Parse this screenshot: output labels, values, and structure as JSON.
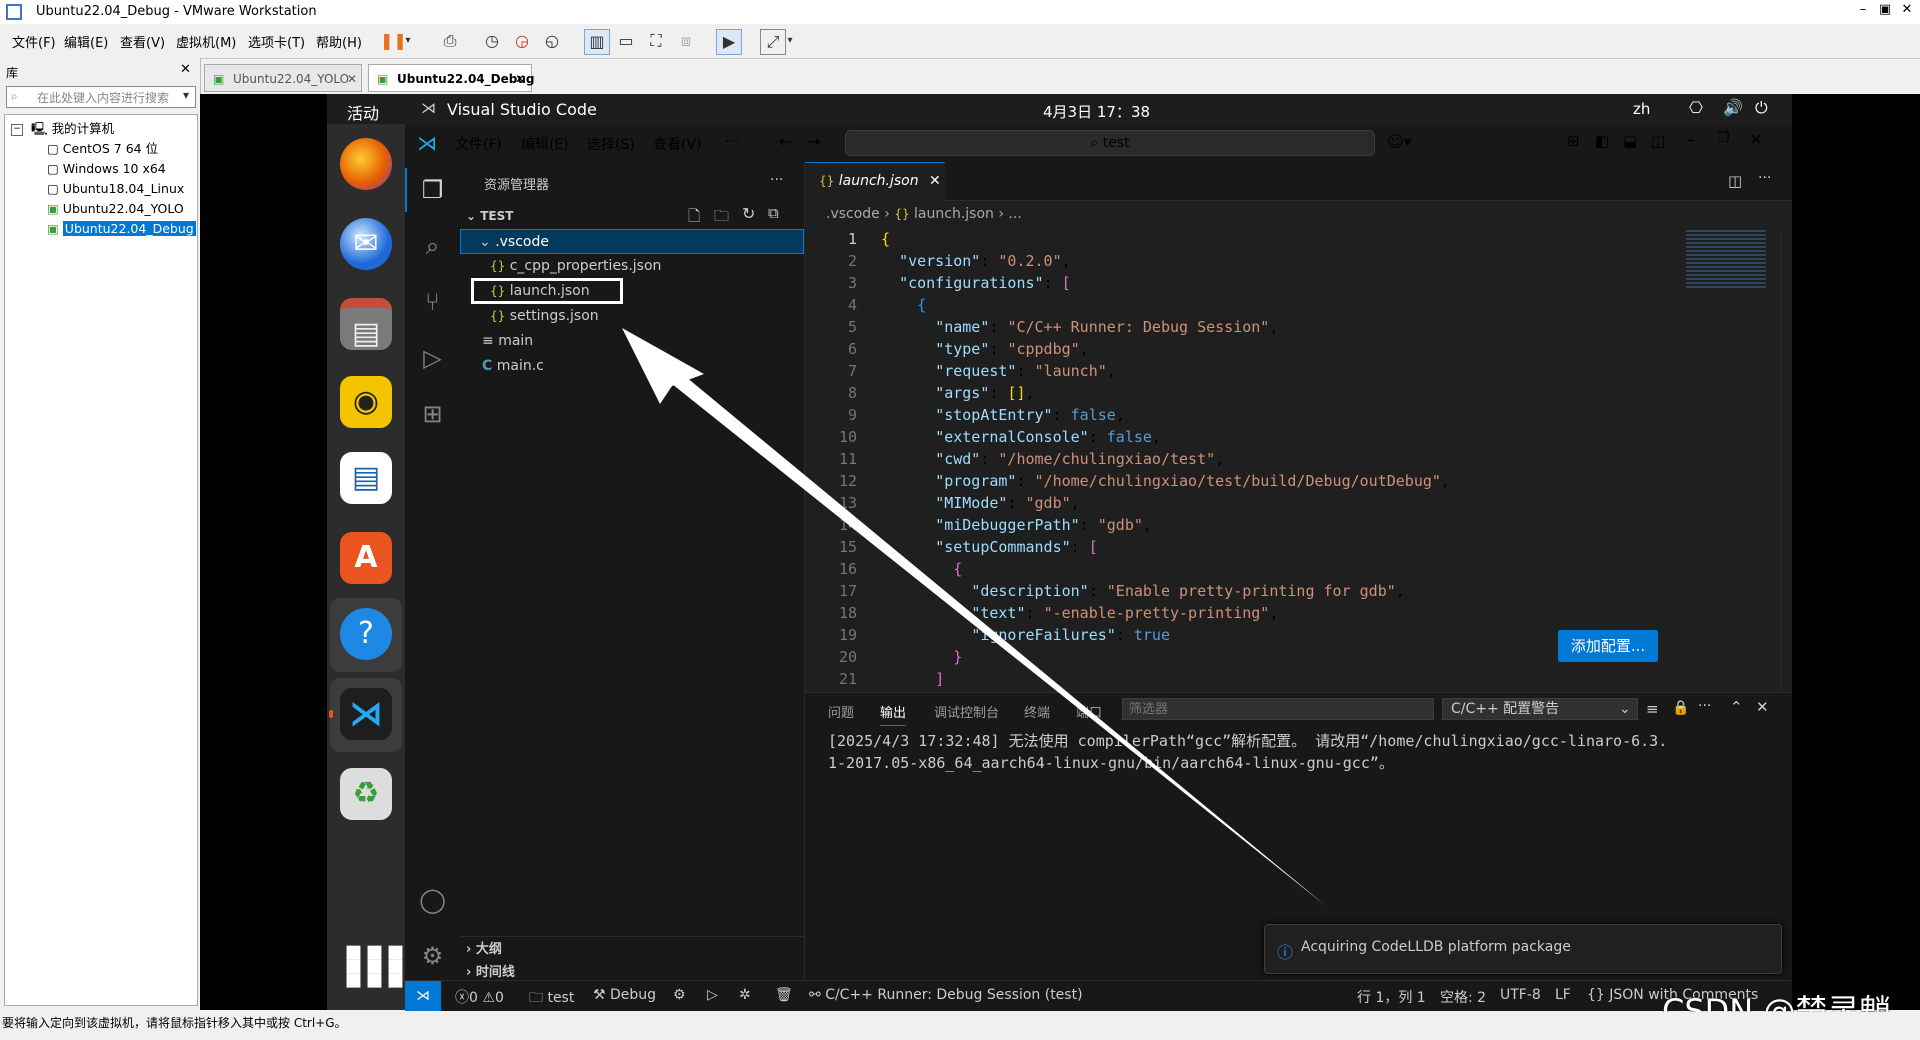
{
  "vmware": {
    "window_title": "Ubuntu22.04_Debug - VMware Workstation",
    "menu": [
      "文件(F)",
      "编辑(E)",
      "查看(V)",
      "虚拟机(M)",
      "选项卡(T)",
      "帮助(H)"
    ],
    "library_title": "库",
    "library_search_placeholder": "在此处键入内容进行搜索",
    "tree_root": "我的计算机",
    "tree_items": [
      "CentOS 7 64 位",
      "Windows 10 x64",
      "Ubuntu18.04_Linux",
      "Ubuntu22.04_YOLO",
      "Ubuntu22.04_Debug"
    ],
    "tabs": [
      "Ubuntu22.04_YOLO",
      "Ubuntu22.04_Debug"
    ],
    "status_text": "要将输入定向到该虚拟机，请将鼠标指针移入其中或按 Ctrl+G。"
  },
  "ubuntu": {
    "activities": "活动",
    "app_name": "Visual Studio Code",
    "clock": "4月3日  17：38",
    "input_method": "zh",
    "dock_tooltip": "帮助"
  },
  "vscode": {
    "menu": [
      "文件(F)",
      "编辑(E)",
      "选择(S)",
      "查看(V)",
      "···"
    ],
    "search_text": "test",
    "explorer_title": "资源管理器",
    "explorer_more": "···",
    "workspace": "TEST",
    "tree": {
      "vscode_folder": ".vscode",
      "files": [
        "c_cpp_properties.json",
        "launch.json",
        "settings.json"
      ],
      "main": "main",
      "main_c": "main.c"
    },
    "outline": "大纲",
    "timeline": "时间线",
    "editor_tab": "launch.json",
    "breadcrumb": [
      ".vscode",
      "launch.json",
      "..."
    ],
    "code_lines": [
      {
        "n": "1",
        "parts": [
          [
            "p",
            "{"
          ]
        ]
      },
      {
        "n": "2",
        "parts": [
          [
            "x",
            "  "
          ],
          [
            "k",
            "\"version\""
          ],
          [
            "x",
            ": "
          ],
          [
            "s",
            "\"0.2.0\""
          ],
          [
            "x",
            ","
          ]
        ]
      },
      {
        "n": "3",
        "parts": [
          [
            "x",
            "  "
          ],
          [
            "k",
            "\"configurations\""
          ],
          [
            "x",
            ": "
          ],
          [
            "pp",
            "["
          ]
        ]
      },
      {
        "n": "4",
        "parts": [
          [
            "x",
            "    "
          ],
          [
            "bl",
            "{"
          ]
        ]
      },
      {
        "n": "5",
        "parts": [
          [
            "x",
            "      "
          ],
          [
            "k",
            "\"name\""
          ],
          [
            "x",
            ": "
          ],
          [
            "s",
            "\"C/C++ Runner: Debug Session\""
          ],
          [
            "x",
            ","
          ]
        ]
      },
      {
        "n": "6",
        "parts": [
          [
            "x",
            "      "
          ],
          [
            "k",
            "\"type\""
          ],
          [
            "x",
            ": "
          ],
          [
            "s",
            "\"cppdbg\""
          ],
          [
            "x",
            ","
          ]
        ]
      },
      {
        "n": "7",
        "parts": [
          [
            "x",
            "      "
          ],
          [
            "k",
            "\"request\""
          ],
          [
            "x",
            ": "
          ],
          [
            "s",
            "\"launch\""
          ],
          [
            "x",
            ","
          ]
        ]
      },
      {
        "n": "8",
        "parts": [
          [
            "x",
            "      "
          ],
          [
            "k",
            "\"args\""
          ],
          [
            "x",
            ": "
          ],
          [
            "p",
            "[]"
          ],
          [
            "x",
            ","
          ]
        ]
      },
      {
        "n": "9",
        "parts": [
          [
            "x",
            "      "
          ],
          [
            "k",
            "\"stopAtEntry\""
          ],
          [
            "x",
            ": "
          ],
          [
            "b",
            "false"
          ],
          [
            "x",
            ","
          ]
        ]
      },
      {
        "n": "10",
        "parts": [
          [
            "x",
            "      "
          ],
          [
            "k",
            "\"externalConsole\""
          ],
          [
            "x",
            ": "
          ],
          [
            "b",
            "false"
          ],
          [
            "x",
            ","
          ]
        ]
      },
      {
        "n": "11",
        "parts": [
          [
            "x",
            "      "
          ],
          [
            "k",
            "\"cwd\""
          ],
          [
            "x",
            ": "
          ],
          [
            "s",
            "\"/home/chulingxiao/test\""
          ],
          [
            "x",
            ","
          ]
        ]
      },
      {
        "n": "12",
        "parts": [
          [
            "x",
            "      "
          ],
          [
            "k",
            "\"program\""
          ],
          [
            "x",
            ": "
          ],
          [
            "s",
            "\"/home/chulingxiao/test/build/Debug/outDebug\""
          ],
          [
            "x",
            ","
          ]
        ]
      },
      {
        "n": "13",
        "parts": [
          [
            "x",
            "      "
          ],
          [
            "k",
            "\"MIMode\""
          ],
          [
            "x",
            ": "
          ],
          [
            "s",
            "\"gdb\""
          ],
          [
            "x",
            ","
          ]
        ]
      },
      {
        "n": "14",
        "parts": [
          [
            "x",
            "      "
          ],
          [
            "k",
            "\"miDebuggerPath\""
          ],
          [
            "x",
            ": "
          ],
          [
            "s",
            "\"gdb\""
          ],
          [
            "x",
            ","
          ]
        ]
      },
      {
        "n": "15",
        "parts": [
          [
            "x",
            "      "
          ],
          [
            "k",
            "\"setupCommands\""
          ],
          [
            "x",
            ": "
          ],
          [
            "pp",
            "["
          ]
        ]
      },
      {
        "n": "16",
        "parts": [
          [
            "x",
            "        "
          ],
          [
            "pp",
            "{"
          ]
        ]
      },
      {
        "n": "17",
        "parts": [
          [
            "x",
            "          "
          ],
          [
            "k",
            "\"description\""
          ],
          [
            "x",
            ": "
          ],
          [
            "s",
            "\"Enable pretty-printing for gdb\""
          ],
          [
            "x",
            ","
          ]
        ]
      },
      {
        "n": "18",
        "parts": [
          [
            "x",
            "          "
          ],
          [
            "k",
            "\"text\""
          ],
          [
            "x",
            ": "
          ],
          [
            "s",
            "\"-enable-pretty-printing\""
          ],
          [
            "x",
            ","
          ]
        ]
      },
      {
        "n": "19",
        "parts": [
          [
            "x",
            "          "
          ],
          [
            "k",
            "\"ignoreFailures\""
          ],
          [
            "x",
            ": "
          ],
          [
            "b",
            "true"
          ]
        ]
      },
      {
        "n": "20",
        "parts": [
          [
            "x",
            "        "
          ],
          [
            "pp",
            "}"
          ]
        ]
      },
      {
        "n": "21",
        "parts": [
          [
            "x",
            "      "
          ],
          [
            "pp",
            "]"
          ]
        ]
      }
    ],
    "add_config_button": "添加配置...",
    "panel_tabs": [
      "问题",
      "输出",
      "调试控制台",
      "终端",
      "端口"
    ],
    "panel_filter_placeholder": "筛选器",
    "panel_dropdown": "C/C++ 配置警告",
    "output_lines": [
      "[2025/4/3 17:32:48] 无法使用 compilerPath“gcc”解析配置。 请改用“/home/chulingxiao/gcc-linaro-6.3.",
      "1-2017.05-x86_64_aarch64-linux-gnu/bin/aarch64-linux-gnu-gcc”。"
    ],
    "notification": "Acquiring CodeLLDB platform package",
    "status": {
      "problems": "0",
      "warnings": "0",
      "folder": "test",
      "build": "Debug",
      "run_config": "C/C++ Runner: Debug Session (test)",
      "position": "行 1，列 1",
      "spaces": "空格: 2",
      "encoding": "UTF-8",
      "eol": "LF",
      "language": "JSON with Comments"
    }
  },
  "watermark": "CSDN @楚灵魈"
}
